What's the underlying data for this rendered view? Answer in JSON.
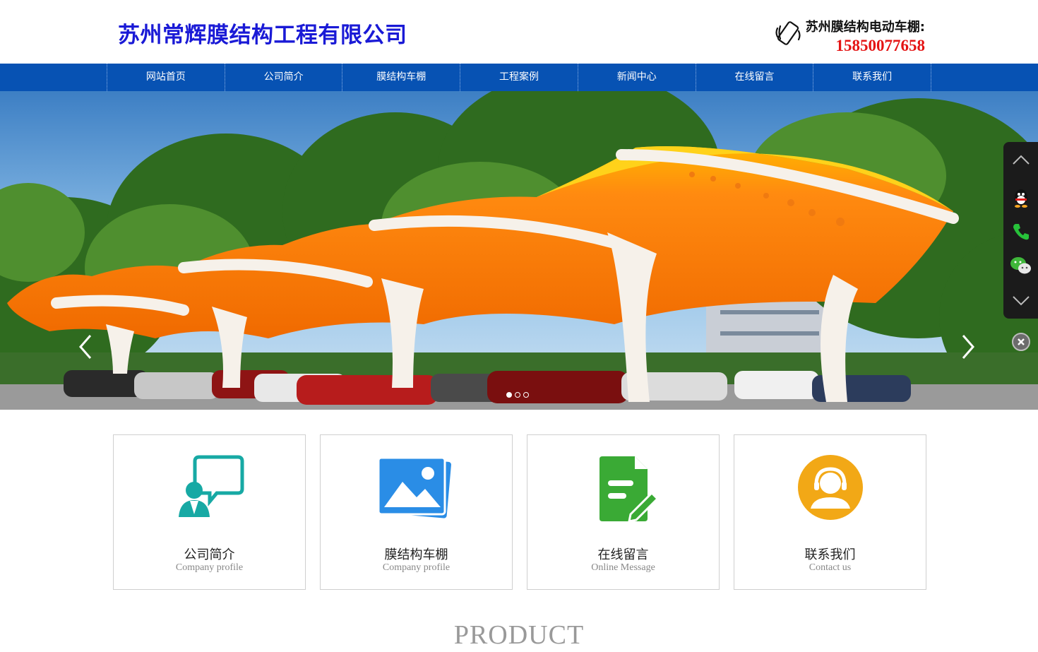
{
  "header": {
    "logo": "苏州常辉膜结构工程有限公司",
    "hotline_label": "苏州膜结构电动车棚:",
    "hotline_phone": "15850077658"
  },
  "nav": {
    "items": [
      "网站首页",
      "公司简介",
      "膜结构车棚",
      "工程案例",
      "新闻中心",
      "在线留言",
      "联系我们"
    ]
  },
  "banner": {
    "slide_count": 3,
    "active_slide": 1,
    "icons": {
      "prev": "chevron-left-icon",
      "next": "chevron-right-icon"
    }
  },
  "sidebar": {
    "icons": [
      "chevron-up-icon",
      "qq-icon",
      "phone-icon",
      "wechat-icon",
      "chevron-down-icon"
    ],
    "close_icon": "close-icon"
  },
  "features": [
    {
      "title": "公司简介",
      "subtitle": "Company profile",
      "icon": "consult-icon",
      "color": "#17a9a4"
    },
    {
      "title": "膜结构车棚",
      "subtitle": "Company profile",
      "icon": "gallery-icon",
      "color": "#2a8de6"
    },
    {
      "title": "在线留言",
      "subtitle": "Online Message",
      "icon": "message-doc-icon",
      "color": "#3aaa35"
    },
    {
      "title": "联系我们",
      "subtitle": "Contact us",
      "icon": "customer-service-icon",
      "color": "#f2a816"
    }
  ],
  "section": {
    "title": "PRODUCT"
  },
  "colors": {
    "nav_bg": "#0752b3",
    "logo": "#1a1ad6",
    "phone": "#e41313"
  }
}
